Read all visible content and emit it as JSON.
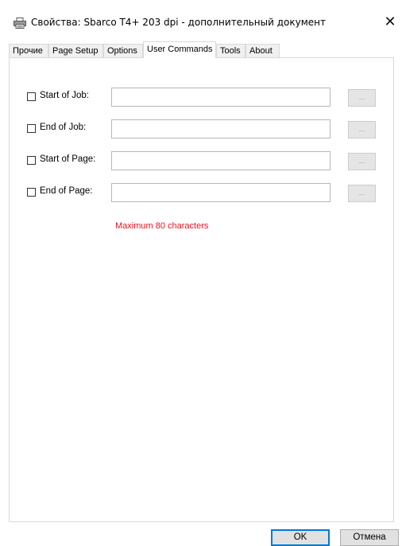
{
  "window": {
    "title": "Свойства: Sbarco T4+ 203 dpi - дополнительный документ",
    "close_glyph": "✕",
    "icon": "printer-icon"
  },
  "tabs": [
    {
      "label": "Прочие",
      "active": false
    },
    {
      "label": "Page Setup",
      "active": false
    },
    {
      "label": "Options",
      "active": false
    },
    {
      "label": "User Commands",
      "active": true
    },
    {
      "label": "Tools",
      "active": false
    },
    {
      "label": "About",
      "active": false
    }
  ],
  "commands": [
    {
      "label": "Start of Job:",
      "checked": false,
      "value": "",
      "browse_label": "..."
    },
    {
      "label": "End of Job:",
      "checked": false,
      "value": "",
      "browse_label": "..."
    },
    {
      "label": "Start of Page:",
      "checked": false,
      "value": "",
      "browse_label": "..."
    },
    {
      "label": "End of Page:",
      "checked": false,
      "value": "",
      "browse_label": "..."
    }
  ],
  "note": {
    "text": "Maximum 80 characters",
    "color": "#e81123"
  },
  "footer": {
    "ok_label": "OK",
    "cancel_label": "Отмена"
  },
  "colors": {
    "accent": "#0078d7"
  }
}
